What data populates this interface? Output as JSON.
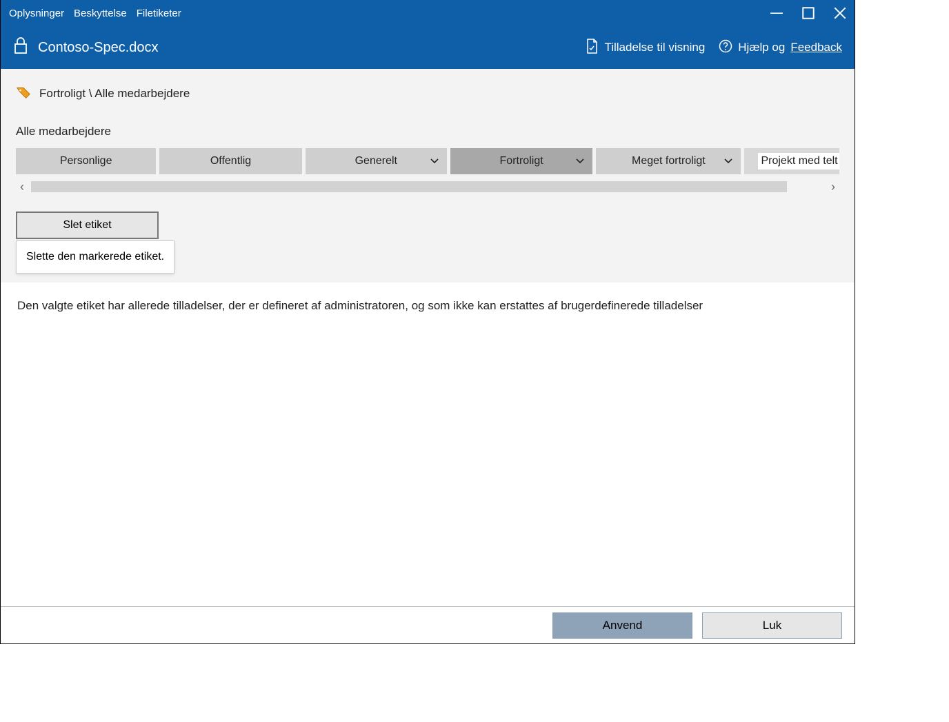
{
  "menu": {
    "info": "Oplysninger",
    "protection": "Beskyttelse",
    "filelabels": "Filetiketer"
  },
  "header": {
    "doc_title": "Contoso-Spec.docx",
    "permission_link": "Tilladelse til visning",
    "help_and": "Hjælp og",
    "feedback": "Feedback"
  },
  "breadcrumb": "Fortroligt \\ Alle medarbejdere",
  "subtitle": "Alle medarbejdere",
  "labels": {
    "personal": "Personlige",
    "public": "Offentlig",
    "general": "Generelt",
    "confidential": "Fortroligt",
    "highly_confidential": "Meget fortroligt",
    "project_tent": "Projekt med telt"
  },
  "delete_button": "Slet etiket",
  "tooltip": "Slette den markerede etiket.",
  "description": "Den valgte etiket har allerede tilladelser, der er defineret af administratoren, og som ikke kan erstattes af brugerdefinerede tilladelser",
  "footer": {
    "apply": "Anvend",
    "close": "Luk"
  }
}
